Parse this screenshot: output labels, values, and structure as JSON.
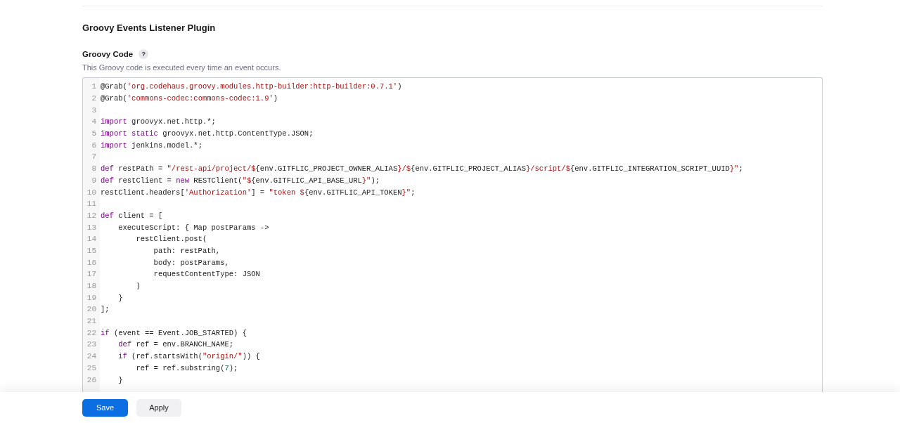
{
  "section_title": "Groovy Events Listener Plugin",
  "field": {
    "label": "Groovy Code",
    "help": "?",
    "description": "This Groovy code is executed every time an event occurs."
  },
  "code_lines": [
    {
      "number": "1",
      "tokens": [
        {
          "kind": "plain",
          "text": "@Grab("
        },
        {
          "kind": "str",
          "text": "'org.codehaus.groovy.modules.http-builder:http-builder:0.7.1'"
        },
        {
          "kind": "plain",
          "text": ")"
        }
      ]
    },
    {
      "number": "2",
      "tokens": [
        {
          "kind": "plain",
          "text": "@Grab("
        },
        {
          "kind": "str",
          "text": "'commons-codec:commons-codec:1.9'"
        },
        {
          "kind": "plain",
          "text": ")"
        }
      ]
    },
    {
      "number": "3"
    },
    {
      "number": "4",
      "tokens": [
        {
          "kind": "kw",
          "text": "import"
        },
        {
          "kind": "plain",
          "text": " groovyx.net.http.*;"
        }
      ]
    },
    {
      "number": "5",
      "tokens": [
        {
          "kind": "kw",
          "text": "import static"
        },
        {
          "kind": "plain",
          "text": " groovyx.net.http.ContentType.JSON;"
        }
      ]
    },
    {
      "number": "6",
      "tokens": [
        {
          "kind": "kw",
          "text": "import"
        },
        {
          "kind": "plain",
          "text": " jenkins.model.*;"
        }
      ]
    },
    {
      "number": "7"
    },
    {
      "number": "8",
      "tokens": [
        {
          "kind": "kw",
          "text": "def"
        },
        {
          "kind": "plain",
          "text": " restPath = "
        },
        {
          "kind": "str",
          "text": "\"/rest-api/project/$"
        },
        {
          "kind": "plain",
          "text": "{env.GITFLIC_PROJECT_OWNER_ALIAS"
        },
        {
          "kind": "str",
          "text": "}/$"
        },
        {
          "kind": "plain",
          "text": "{env.GITFLIC_PROJECT_ALIAS"
        },
        {
          "kind": "str",
          "text": "}/script/$"
        },
        {
          "kind": "plain",
          "text": "{env.GITFLIC_INTEGRATION_SCRIPT_UUID"
        },
        {
          "kind": "str",
          "text": "}\""
        },
        {
          "kind": "plain",
          "text": ";"
        }
      ]
    },
    {
      "number": "9",
      "tokens": [
        {
          "kind": "kw",
          "text": "def"
        },
        {
          "kind": "plain",
          "text": " restClient = "
        },
        {
          "kind": "kw",
          "text": "new"
        },
        {
          "kind": "plain",
          "text": " RESTClient("
        },
        {
          "kind": "str",
          "text": "\"$"
        },
        {
          "kind": "plain",
          "text": "{env.GITFLIC_API_BASE_URL"
        },
        {
          "kind": "str",
          "text": "}\""
        },
        {
          "kind": "plain",
          "text": ");"
        }
      ]
    },
    {
      "number": "10",
      "tokens": [
        {
          "kind": "plain",
          "text": "restClient.headers["
        },
        {
          "kind": "str",
          "text": "'Authorization'"
        },
        {
          "kind": "plain",
          "text": "] = "
        },
        {
          "kind": "str",
          "text": "\"token $"
        },
        {
          "kind": "plain",
          "text": "{env.GITFLIC_API_TOKEN"
        },
        {
          "kind": "str",
          "text": "}\""
        },
        {
          "kind": "plain",
          "text": ";"
        }
      ]
    },
    {
      "number": "11"
    },
    {
      "number": "12",
      "tokens": [
        {
          "kind": "kw",
          "text": "def"
        },
        {
          "kind": "plain",
          "text": " client = ["
        }
      ]
    },
    {
      "number": "13",
      "tokens": [
        {
          "kind": "plain",
          "text": "    executeScript: { Map postParams ->"
        }
      ]
    },
    {
      "number": "14",
      "tokens": [
        {
          "kind": "plain",
          "text": "        restClient.post("
        }
      ]
    },
    {
      "number": "15",
      "tokens": [
        {
          "kind": "plain",
          "text": "            path: restPath,"
        }
      ]
    },
    {
      "number": "16",
      "tokens": [
        {
          "kind": "plain",
          "text": "            body: postParams,"
        }
      ]
    },
    {
      "number": "17",
      "tokens": [
        {
          "kind": "plain",
          "text": "            requestContentType: JSON"
        }
      ]
    },
    {
      "number": "18",
      "tokens": [
        {
          "kind": "plain",
          "text": "        )"
        }
      ]
    },
    {
      "number": "19",
      "tokens": [
        {
          "kind": "plain",
          "text": "    }"
        }
      ]
    },
    {
      "number": "20",
      "tokens": [
        {
          "kind": "plain",
          "text": "];"
        }
      ]
    },
    {
      "number": "21"
    },
    {
      "number": "22",
      "tokens": [
        {
          "kind": "kw",
          "text": "if"
        },
        {
          "kind": "plain",
          "text": " (event == Event.JOB_STARTED) {"
        }
      ]
    },
    {
      "number": "23",
      "tokens": [
        {
          "kind": "kw",
          "text": "    def"
        },
        {
          "kind": "plain",
          "text": " ref = env.BRANCH_NAME;"
        }
      ]
    },
    {
      "number": "24",
      "tokens": [
        {
          "kind": "kw",
          "text": "    if"
        },
        {
          "kind": "plain",
          "text": " (ref.startsWith("
        },
        {
          "kind": "str",
          "text": "\"origin/\""
        },
        {
          "kind": "plain",
          "text": ")) {"
        }
      ]
    },
    {
      "number": "25",
      "tokens": [
        {
          "kind": "plain",
          "text": "        ref = ref.substring("
        },
        {
          "kind": "num",
          "text": "7"
        },
        {
          "kind": "plain",
          "text": ");"
        }
      ]
    },
    {
      "number": "26",
      "tokens": [
        {
          "kind": "plain",
          "text": "    }"
        }
      ]
    }
  ],
  "buttons": [
    {
      "label": "Save",
      "kind": "primary"
    },
    {
      "label": "Apply",
      "kind": "secondary"
    }
  ]
}
